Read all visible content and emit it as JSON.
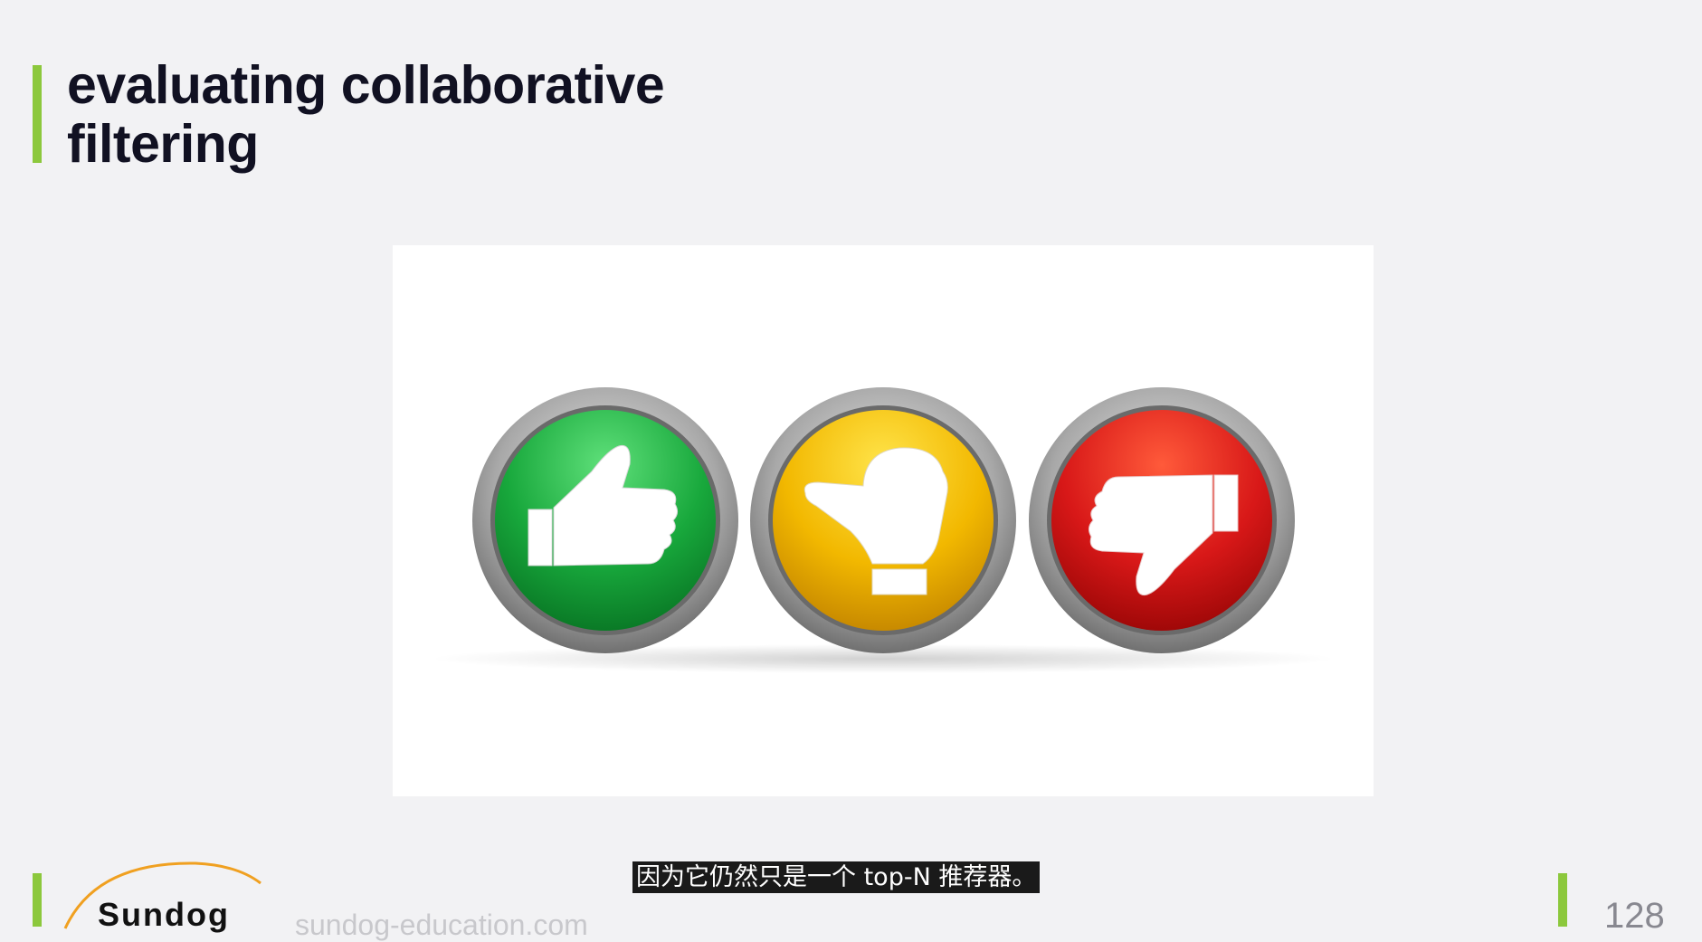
{
  "slide": {
    "title": "evaluating collaborative filtering",
    "page_number": "128"
  },
  "image": {
    "icons": [
      "thumbs-up-icon",
      "thumbs-sideways-icon",
      "thumbs-down-icon"
    ],
    "colors": {
      "green": "#1db84a",
      "yellow": "#f2b800",
      "red": "#d81818"
    }
  },
  "caption": {
    "text": "因为它仍然只是一个 top-N 推荐器。"
  },
  "footer": {
    "logo_text": "Sundog",
    "url": "sundog-education.com",
    "accent_color": "#8cc83c"
  }
}
